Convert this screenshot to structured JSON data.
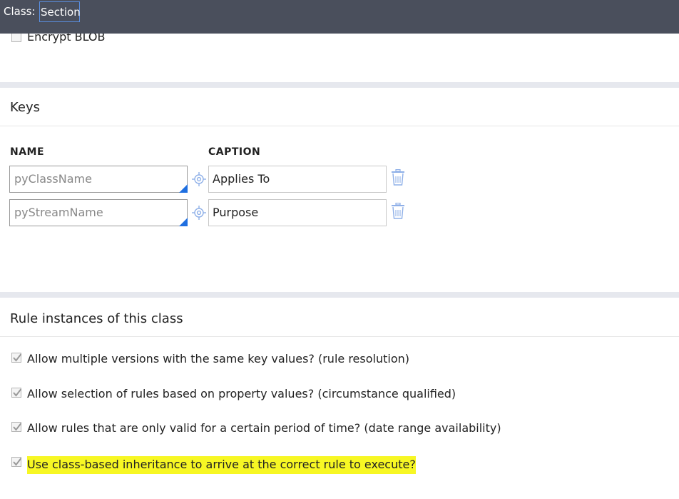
{
  "header": {
    "class_label": "Class:",
    "class_value": "Section"
  },
  "storage": {
    "encrypt_blob_label": "Encrypt BLOB",
    "encrypt_blob_checked": false
  },
  "keys": {
    "title": "Keys",
    "name_header": "NAME",
    "caption_header": "CAPTION",
    "rows": [
      {
        "name": "pyClassName",
        "caption": "Applies To"
      },
      {
        "name": "pyStreamName",
        "caption": "Purpose"
      }
    ]
  },
  "rule_instances": {
    "title": "Rule instances of this class",
    "options": [
      {
        "label": "Allow multiple versions with the same key values? (rule resolution)",
        "checked": true
      },
      {
        "label": "Allow selection of rules based on property values? (circumstance qualified)",
        "checked": true
      },
      {
        "label": "Allow rules that are only valid for a certain period of time? (date range availability)",
        "checked": true
      },
      {
        "label": "Use class-based inheritance to arrive at the correct rule to execute?",
        "checked": true,
        "highlighted": true
      }
    ]
  },
  "colors": {
    "header_bg": "#4a4f5c",
    "highlight": "#f7f724",
    "accent_blue": "#1f6fe0",
    "icon_blue": "#8fb0e8"
  },
  "icons": {
    "property_picker": "target-icon",
    "delete": "trash-icon",
    "checkbox_mark": "checkmark-icon"
  }
}
